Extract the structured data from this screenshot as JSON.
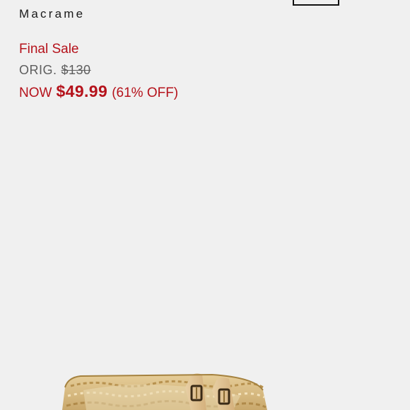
{
  "product": {
    "title": "Macrame",
    "status": "Final Sale",
    "orig_label": "ORIG.",
    "orig_price": "$130",
    "now_label": "NOW",
    "now_price": "$49.99",
    "discount": "(61% OFF)"
  },
  "colors": {
    "sale_red": "#b5121b",
    "muted_gray": "#5e5e5e",
    "background": "#f0f0f0"
  }
}
